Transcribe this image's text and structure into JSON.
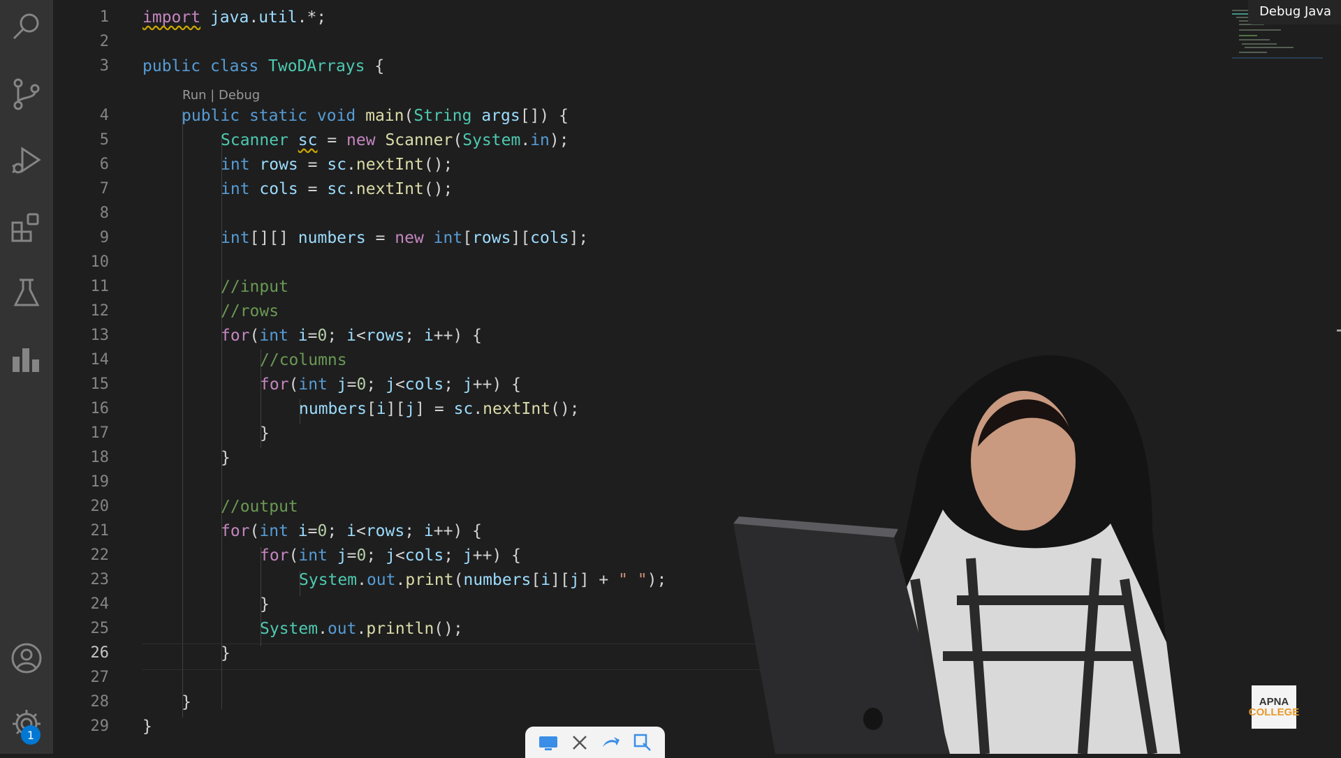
{
  "code_lens": {
    "run": "Run",
    "separator": " | ",
    "debug": "Debug"
  },
  "tooltip": "Debug Java",
  "settings_badge": "1",
  "logo": {
    "line1": "APNA",
    "line2": "COLLEGE"
  },
  "line_numbers": [
    "1",
    "2",
    "3",
    "4",
    "5",
    "6",
    "7",
    "8",
    "9",
    "10",
    "11",
    "12",
    "13",
    "14",
    "15",
    "16",
    "17",
    "18",
    "19",
    "20",
    "21",
    "22",
    "23",
    "24",
    "25",
    "26",
    "27",
    "28",
    "29"
  ],
  "active_line": "26",
  "code": {
    "l1": [
      {
        "t": "import",
        "c": "ctl"
      },
      {
        "t": " java",
        "c": "var"
      },
      {
        "t": ".",
        "c": "pl"
      },
      {
        "t": "util",
        "c": "var"
      },
      {
        "t": ".*;",
        "c": "pl"
      }
    ],
    "l3": [
      {
        "t": "public",
        "c": "kw"
      },
      {
        "t": " class ",
        "c": "kw"
      },
      {
        "t": "TwoDArrays",
        "c": "ty"
      },
      {
        "t": " {",
        "c": "pl"
      }
    ],
    "l4": [
      {
        "t": "public",
        "c": "kw"
      },
      {
        "t": " static ",
        "c": "kw"
      },
      {
        "t": "void",
        "c": "kw"
      },
      {
        "t": " main",
        "c": "fn"
      },
      {
        "t": "(",
        "c": "pl"
      },
      {
        "t": "String",
        "c": "ty"
      },
      {
        "t": " args",
        "c": "var"
      },
      {
        "t": "[]) {",
        "c": "pl"
      }
    ],
    "l5": [
      {
        "t": "Scanner",
        "c": "ty"
      },
      {
        "t": " ",
        "c": "pl"
      },
      {
        "t": "sc",
        "c": "var"
      },
      {
        "t": " = ",
        "c": "pl"
      },
      {
        "t": "new",
        "c": "ctl"
      },
      {
        "t": " Scanner",
        "c": "fn"
      },
      {
        "t": "(",
        "c": "pl"
      },
      {
        "t": "System",
        "c": "ty"
      },
      {
        "t": ".",
        "c": "pl"
      },
      {
        "t": "in",
        "c": "kw"
      },
      {
        "t": ");",
        "c": "pl"
      }
    ],
    "l6": [
      {
        "t": "int",
        "c": "kw"
      },
      {
        "t": " rows",
        "c": "var"
      },
      {
        "t": " = ",
        "c": "pl"
      },
      {
        "t": "sc",
        "c": "var"
      },
      {
        "t": ".",
        "c": "pl"
      },
      {
        "t": "nextInt",
        "c": "fn"
      },
      {
        "t": "();",
        "c": "pl"
      }
    ],
    "l7": [
      {
        "t": "int",
        "c": "kw"
      },
      {
        "t": " cols",
        "c": "var"
      },
      {
        "t": " = ",
        "c": "pl"
      },
      {
        "t": "sc",
        "c": "var"
      },
      {
        "t": ".",
        "c": "pl"
      },
      {
        "t": "nextInt",
        "c": "fn"
      },
      {
        "t": "();",
        "c": "pl"
      }
    ],
    "l9": [
      {
        "t": "int",
        "c": "kw"
      },
      {
        "t": "[][] ",
        "c": "pl"
      },
      {
        "t": "numbers",
        "c": "var"
      },
      {
        "t": " = ",
        "c": "pl"
      },
      {
        "t": "new",
        "c": "ctl"
      },
      {
        "t": " int",
        "c": "kw"
      },
      {
        "t": "[",
        "c": "pl"
      },
      {
        "t": "rows",
        "c": "var"
      },
      {
        "t": "][",
        "c": "pl"
      },
      {
        "t": "cols",
        "c": "var"
      },
      {
        "t": "];",
        "c": "pl"
      }
    ],
    "l11": [
      {
        "t": "//input",
        "c": "com"
      }
    ],
    "l12": [
      {
        "t": "//rows",
        "c": "com"
      }
    ],
    "l13": [
      {
        "t": "for",
        "c": "ctl"
      },
      {
        "t": "(",
        "c": "pl"
      },
      {
        "t": "int",
        "c": "kw"
      },
      {
        "t": " i",
        "c": "var"
      },
      {
        "t": "=",
        "c": "pl"
      },
      {
        "t": "0",
        "c": "num"
      },
      {
        "t": "; ",
        "c": "pl"
      },
      {
        "t": "i",
        "c": "var"
      },
      {
        "t": "<",
        "c": "pl"
      },
      {
        "t": "rows",
        "c": "var"
      },
      {
        "t": "; ",
        "c": "pl"
      },
      {
        "t": "i",
        "c": "var"
      },
      {
        "t": "++) {",
        "c": "pl"
      }
    ],
    "l14": [
      {
        "t": "//columns",
        "c": "com"
      }
    ],
    "l15": [
      {
        "t": "for",
        "c": "ctl"
      },
      {
        "t": "(",
        "c": "pl"
      },
      {
        "t": "int",
        "c": "kw"
      },
      {
        "t": " j",
        "c": "var"
      },
      {
        "t": "=",
        "c": "pl"
      },
      {
        "t": "0",
        "c": "num"
      },
      {
        "t": "; ",
        "c": "pl"
      },
      {
        "t": "j",
        "c": "var"
      },
      {
        "t": "<",
        "c": "pl"
      },
      {
        "t": "cols",
        "c": "var"
      },
      {
        "t": "; ",
        "c": "pl"
      },
      {
        "t": "j",
        "c": "var"
      },
      {
        "t": "++) {",
        "c": "pl"
      }
    ],
    "l16": [
      {
        "t": "numbers",
        "c": "var"
      },
      {
        "t": "[",
        "c": "pl"
      },
      {
        "t": "i",
        "c": "var"
      },
      {
        "t": "][",
        "c": "pl"
      },
      {
        "t": "j",
        "c": "var"
      },
      {
        "t": "] = ",
        "c": "pl"
      },
      {
        "t": "sc",
        "c": "var"
      },
      {
        "t": ".",
        "c": "pl"
      },
      {
        "t": "nextInt",
        "c": "fn"
      },
      {
        "t": "();",
        "c": "pl"
      }
    ],
    "l17": [
      {
        "t": "}",
        "c": "pl"
      }
    ],
    "l18": [
      {
        "t": "}",
        "c": "pl"
      }
    ],
    "l20": [
      {
        "t": "//output",
        "c": "com"
      }
    ],
    "l21": [
      {
        "t": "for",
        "c": "ctl"
      },
      {
        "t": "(",
        "c": "pl"
      },
      {
        "t": "int",
        "c": "kw"
      },
      {
        "t": " i",
        "c": "var"
      },
      {
        "t": "=",
        "c": "pl"
      },
      {
        "t": "0",
        "c": "num"
      },
      {
        "t": "; ",
        "c": "pl"
      },
      {
        "t": "i",
        "c": "var"
      },
      {
        "t": "<",
        "c": "pl"
      },
      {
        "t": "rows",
        "c": "var"
      },
      {
        "t": "; ",
        "c": "pl"
      },
      {
        "t": "i",
        "c": "var"
      },
      {
        "t": "++) {",
        "c": "pl"
      }
    ],
    "l22": [
      {
        "t": "for",
        "c": "ctl"
      },
      {
        "t": "(",
        "c": "pl"
      },
      {
        "t": "int",
        "c": "kw"
      },
      {
        "t": " j",
        "c": "var"
      },
      {
        "t": "=",
        "c": "pl"
      },
      {
        "t": "0",
        "c": "num"
      },
      {
        "t": "; ",
        "c": "pl"
      },
      {
        "t": "j",
        "c": "var"
      },
      {
        "t": "<",
        "c": "pl"
      },
      {
        "t": "cols",
        "c": "var"
      },
      {
        "t": "; ",
        "c": "pl"
      },
      {
        "t": "j",
        "c": "var"
      },
      {
        "t": "++) {",
        "c": "pl"
      }
    ],
    "l23": [
      {
        "t": "System",
        "c": "ty"
      },
      {
        "t": ".",
        "c": "pl"
      },
      {
        "t": "out",
        "c": "kw"
      },
      {
        "t": ".",
        "c": "pl"
      },
      {
        "t": "print",
        "c": "fn"
      },
      {
        "t": "(",
        "c": "pl"
      },
      {
        "t": "numbers",
        "c": "var"
      },
      {
        "t": "[",
        "c": "pl"
      },
      {
        "t": "i",
        "c": "var"
      },
      {
        "t": "][",
        "c": "pl"
      },
      {
        "t": "j",
        "c": "var"
      },
      {
        "t": "] + ",
        "c": "pl"
      },
      {
        "t": "\" \"",
        "c": "str"
      },
      {
        "t": ");",
        "c": "pl"
      }
    ],
    "l24": [
      {
        "t": "}",
        "c": "pl"
      }
    ],
    "l25": [
      {
        "t": "System",
        "c": "ty"
      },
      {
        "t": ".",
        "c": "pl"
      },
      {
        "t": "out",
        "c": "kw"
      },
      {
        "t": ".",
        "c": "pl"
      },
      {
        "t": "println",
        "c": "fn"
      },
      {
        "t": "();",
        "c": "pl"
      }
    ],
    "l26": [
      {
        "t": "}",
        "c": "pl"
      }
    ],
    "l28": [
      {
        "t": "}",
        "c": "pl"
      }
    ],
    "l29": [
      {
        "t": "}",
        "c": "pl"
      }
    ]
  }
}
